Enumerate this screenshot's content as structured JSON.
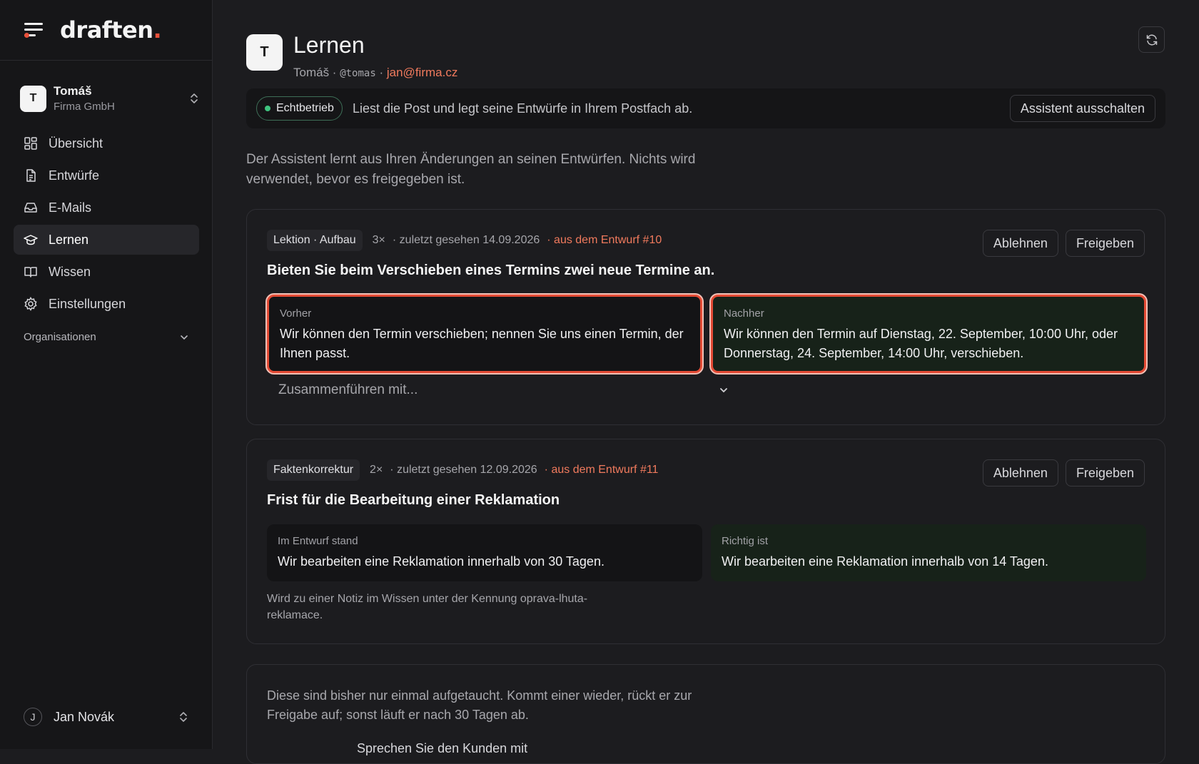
{
  "app": {
    "logo_text": "draften",
    "logo_dot": "."
  },
  "org": {
    "avatar": "T",
    "name": "Tomáš",
    "sub": "Firma GmbH"
  },
  "nav": {
    "items": [
      {
        "label": "Übersicht",
        "icon": "grid-icon"
      },
      {
        "label": "Entwürfe",
        "icon": "document-icon"
      },
      {
        "label": "E-Mails",
        "icon": "inbox-icon"
      },
      {
        "label": "Lernen",
        "icon": "graduation-cap-icon",
        "active": true
      },
      {
        "label": "Wissen",
        "icon": "book-icon"
      },
      {
        "label": "Einstellungen",
        "icon": "gear-icon"
      }
    ],
    "section_label": "Organisationen"
  },
  "user": {
    "avatar": "J",
    "name": "Jan Novák"
  },
  "header": {
    "avatar": "T",
    "title": "Lernen",
    "name": "Tomáš",
    "sep1": " · ",
    "handle": "@tomas",
    "sep2": " · ",
    "email": "jan@firma.cz"
  },
  "status": {
    "badge": "Echtbetrieb",
    "text": "Liest die Post und legt seine Entwürfe in Ihrem Postfach ab.",
    "button": "Assistent ausschalten"
  },
  "intro": "Der Assistent lernt aus Ihren Änderungen an seinen Entwürfen. Nichts wird verwendet, bevor es freigegeben ist.",
  "cards": [
    {
      "tag": "Lektion · Aufbau",
      "count": "3×",
      "seen": "· zuletzt gesehen 14.09.2026",
      "source": "· aus dem Entwurf #10",
      "reject": "Ablehnen",
      "approve": "Freigeben",
      "title": "Bieten Sie beim Verschieben eines Termins zwei neue Termine an.",
      "left_label": "Vorher",
      "left_text": "Wir können den Termin verschieben; nennen Sie uns einen Termin, der Ihnen passt.",
      "right_label": "Nachher",
      "right_text": "Wir können den Termin auf Dienstag, 22. September, 10:00 Uhr, oder Donnerstag, 24. September, 14:00 Uhr, verschieben.",
      "merge_placeholder": "Zusammenführen mit..."
    },
    {
      "tag": "Faktenkorrektur",
      "count": "2×",
      "seen": "· zuletzt gesehen 12.09.2026",
      "source": "· aus dem Entwurf #11",
      "reject": "Ablehnen",
      "approve": "Freigeben",
      "title": "Frist für die Bearbeitung einer Reklamation",
      "left_label": "Im Entwurf stand",
      "left_text": "Wir bearbeiten eine Reklamation innerhalb von 30 Tagen.",
      "right_label": "Richtig ist",
      "right_text": "Wir bearbeiten eine Reklamation innerhalb von 14 Tagen.",
      "note": "Wird zu einer Notiz im Wissen unter der Kennung oprava-lhuta-reklamace."
    }
  ],
  "pending": {
    "text": "Diese sind bisher nur einmal aufgetaucht. Kommt einer wieder, rückt er zur Freigabe auf; sonst läuft er nach 30 Tagen ab.",
    "peek": "Sprechen Sie den Kunden mit"
  },
  "colors": {
    "accent": "#e8503a",
    "link": "#f07a5d",
    "live": "#3fc37f",
    "highlight": "#e44a34"
  }
}
